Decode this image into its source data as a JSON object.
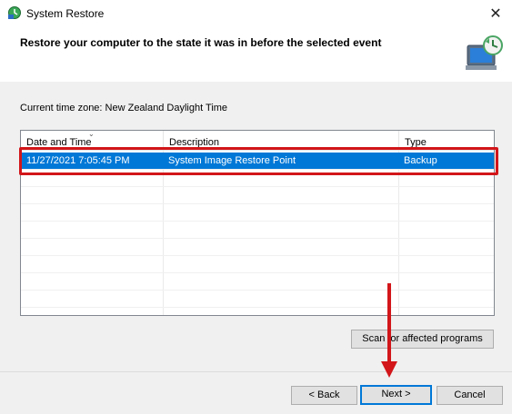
{
  "window": {
    "title": "System Restore",
    "close_glyph": "✕"
  },
  "header": {
    "title": "Restore your computer to the state it was in before the selected event"
  },
  "timezone": {
    "label": "Current time zone: New Zealand Daylight Time"
  },
  "table": {
    "columns": [
      "Date and Time",
      "Description",
      "Type"
    ],
    "rows": [
      {
        "date_time": "11/27/2021 7:05:45 PM",
        "description": "System Image Restore Point",
        "type": "Backup",
        "selected": true
      }
    ]
  },
  "buttons": {
    "scan": "Scan for affected programs",
    "back": "< Back",
    "next": "Next >",
    "cancel": "Cancel"
  },
  "colors": {
    "selection": "#0078d7",
    "annotation_red": "#d2161a"
  },
  "icons": {
    "app": "system-restore-icon",
    "header": "monitor-restore-icon",
    "close": "close-icon",
    "sort": "sort-arrow-icon"
  }
}
